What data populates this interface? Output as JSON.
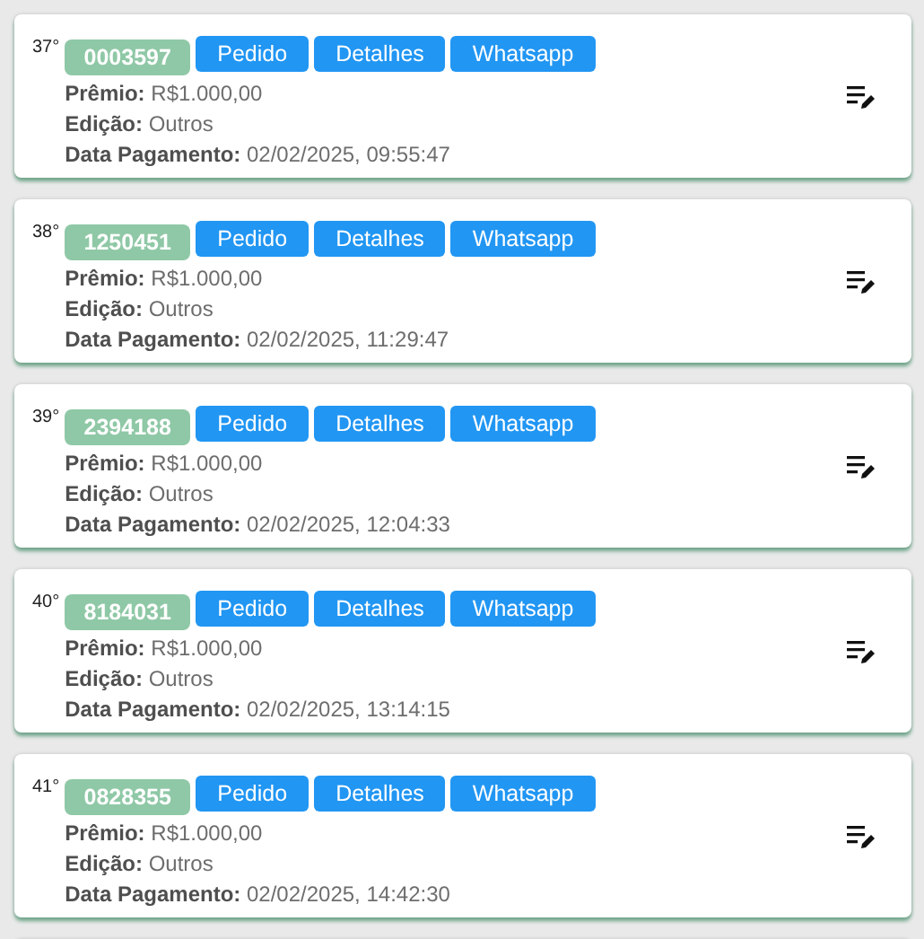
{
  "entries": [
    {
      "rank": "37°",
      "code": "0003597",
      "buttons": [
        "Pedido",
        "Detalhes",
        "Whatsapp"
      ],
      "fields": [
        {
          "label": "Prêmio:",
          "value": "R$1.000,00"
        },
        {
          "label": "Edição:",
          "value": "Outros"
        },
        {
          "label": "Data Pagamento:",
          "value": "02/02/2025, 09:55:47"
        }
      ]
    },
    {
      "rank": "38°",
      "code": "1250451",
      "buttons": [
        "Pedido",
        "Detalhes",
        "Whatsapp"
      ],
      "fields": [
        {
          "label": "Prêmio:",
          "value": "R$1.000,00"
        },
        {
          "label": "Edição:",
          "value": "Outros"
        },
        {
          "label": "Data Pagamento:",
          "value": "02/02/2025, 11:29:47"
        }
      ]
    },
    {
      "rank": "39°",
      "code": "2394188",
      "buttons": [
        "Pedido",
        "Detalhes",
        "Whatsapp"
      ],
      "fields": [
        {
          "label": "Prêmio:",
          "value": "R$1.000,00"
        },
        {
          "label": "Edição:",
          "value": "Outros"
        },
        {
          "label": "Data Pagamento:",
          "value": "02/02/2025, 12:04:33"
        }
      ]
    },
    {
      "rank": "40°",
      "code": "8184031",
      "buttons": [
        "Pedido",
        "Detalhes",
        "Whatsapp"
      ],
      "fields": [
        {
          "label": "Prêmio:",
          "value": "R$1.000,00"
        },
        {
          "label": "Edição:",
          "value": "Outros"
        },
        {
          "label": "Data Pagamento:",
          "value": "02/02/2025, 13:14:15"
        }
      ]
    },
    {
      "rank": "41°",
      "code": "0828355",
      "buttons": [
        "Pedido",
        "Detalhes",
        "Whatsapp"
      ],
      "fields": [
        {
          "label": "Prêmio:",
          "value": "R$1.000,00"
        },
        {
          "label": "Edição:",
          "value": "Outros"
        },
        {
          "label": "Data Pagamento:",
          "value": "02/02/2025, 14:42:30"
        }
      ]
    }
  ]
}
